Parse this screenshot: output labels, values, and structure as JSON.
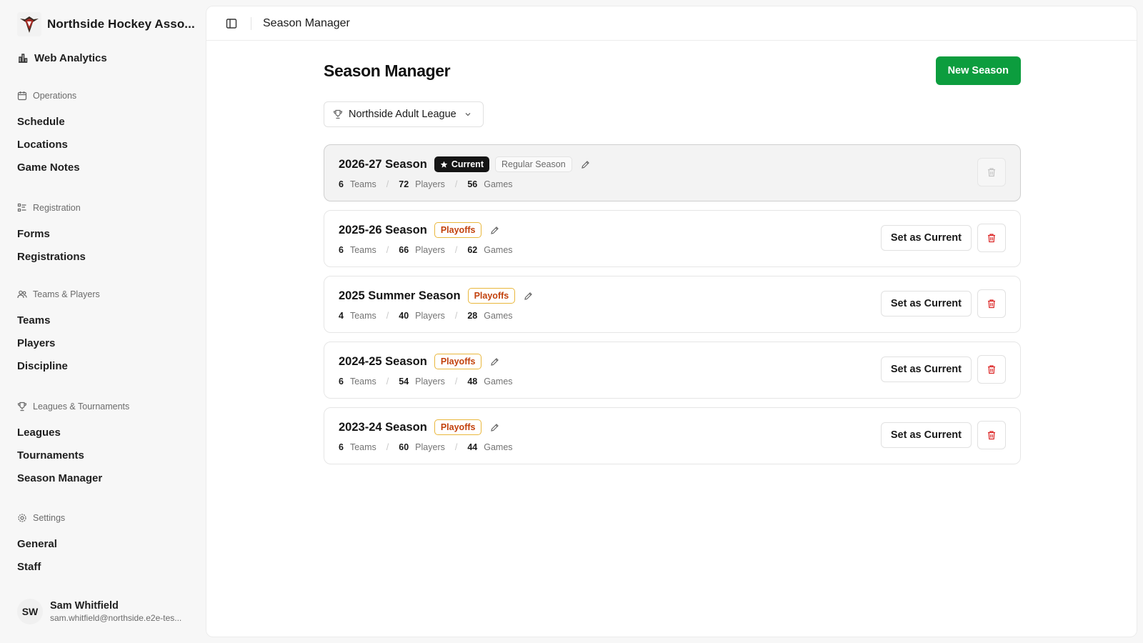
{
  "brand": {
    "name": "Northside Hockey Asso..."
  },
  "nav_top": {
    "label": "Web Analytics",
    "icon": "bar-chart-icon"
  },
  "groups": [
    {
      "title": "Operations",
      "icon": "calendar-icon",
      "items": [
        "Schedule",
        "Locations",
        "Game Notes"
      ]
    },
    {
      "title": "Registration",
      "icon": "list-icon",
      "items": [
        "Forms",
        "Registrations"
      ]
    },
    {
      "title": "Teams & Players",
      "icon": "users-icon",
      "items": [
        "Teams",
        "Players",
        "Discipline"
      ]
    },
    {
      "title": "Leagues & Tournaments",
      "icon": "trophy-icon",
      "items": [
        "Leagues",
        "Tournaments",
        "Season Manager"
      ]
    },
    {
      "title": "Settings",
      "icon": "gear-icon",
      "items": [
        "General",
        "Staff"
      ]
    }
  ],
  "user": {
    "initials": "SW",
    "name": "Sam Whitfield",
    "email": "sam.whitfield@northside.e2e-tes..."
  },
  "topbar": {
    "breadcrumb": "Season Manager"
  },
  "page": {
    "title": "Season Manager",
    "new_button": "New Season"
  },
  "league_select": {
    "value": "Northside Adult League"
  },
  "labels": {
    "teams": "Teams",
    "players": "Players",
    "games": "Games",
    "set_current": "Set as Current",
    "current": "Current"
  },
  "seasons": [
    {
      "name": "2026-27 Season",
      "current": true,
      "type": "Regular Season",
      "teams": "6",
      "players": "72",
      "games": "56"
    },
    {
      "name": "2025-26 Season",
      "current": false,
      "type": "Playoffs",
      "teams": "6",
      "players": "66",
      "games": "62"
    },
    {
      "name": "2025 Summer Season",
      "current": false,
      "type": "Playoffs",
      "teams": "4",
      "players": "40",
      "games": "28"
    },
    {
      "name": "2024-25 Season",
      "current": false,
      "type": "Playoffs",
      "teams": "6",
      "players": "54",
      "games": "48"
    },
    {
      "name": "2023-24 Season",
      "current": false,
      "type": "Playoffs",
      "teams": "6",
      "players": "60",
      "games": "44"
    }
  ],
  "colors": {
    "primary_green": "#0c9d3e",
    "playoffs_text": "#c2410c",
    "playoffs_border": "#e9b73c",
    "delete_red": "#dc2626"
  }
}
